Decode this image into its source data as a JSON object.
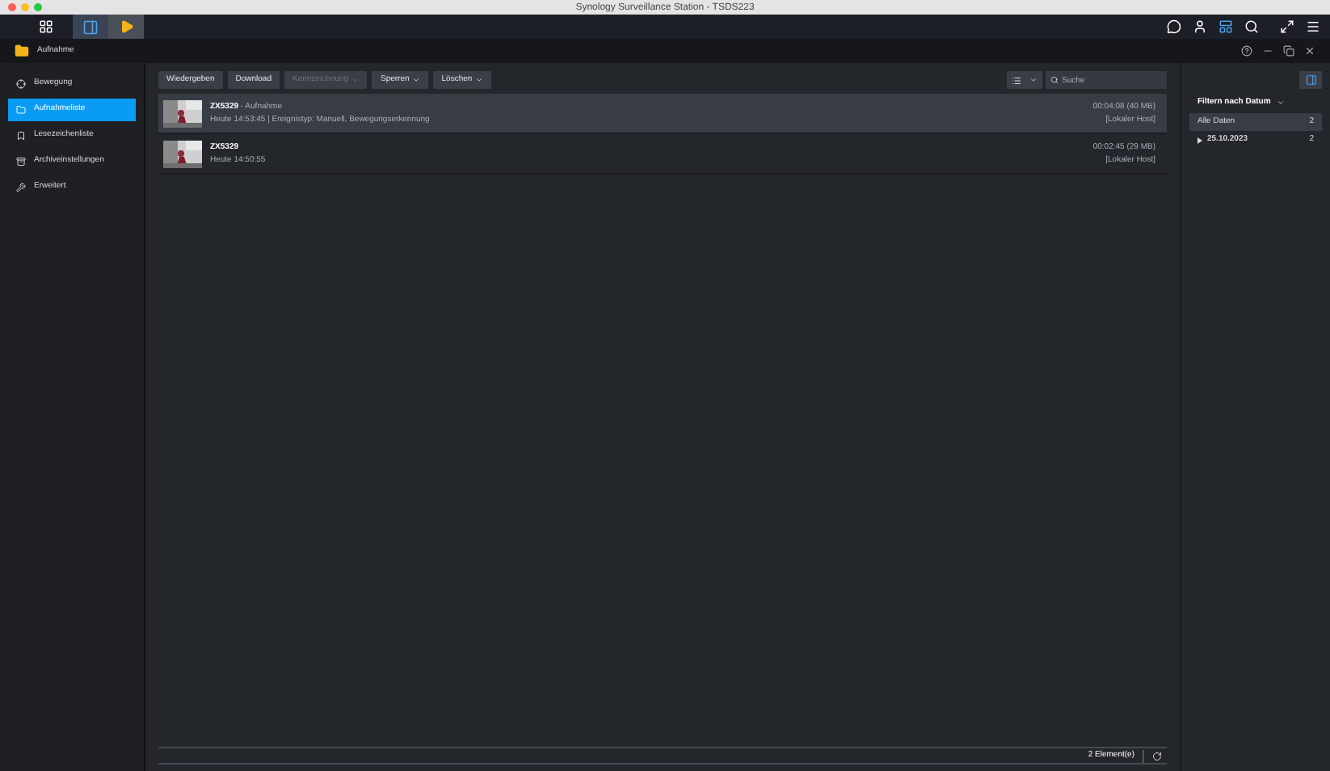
{
  "mac_title": "Synology Surveillance Station - TSDS223",
  "window": {
    "title": "Aufnahme"
  },
  "sidebar": {
    "items": [
      {
        "label": "Bewegung",
        "selected": false
      },
      {
        "label": "Aufnahmeliste",
        "selected": true
      },
      {
        "label": "Lesezeichenliste",
        "selected": false
      },
      {
        "label": "Archiveinstellungen",
        "selected": false
      },
      {
        "label": "Erweitert",
        "selected": false
      }
    ]
  },
  "toolbar": {
    "buttons": [
      {
        "label": "Wiedergeben",
        "disabled": false,
        "dropdown": false
      },
      {
        "label": "Download",
        "disabled": false,
        "dropdown": false
      },
      {
        "label": "Kennzeichnung",
        "disabled": true,
        "dropdown": true
      },
      {
        "label": "Sperren",
        "disabled": false,
        "dropdown": true
      },
      {
        "label": "Löschen",
        "disabled": false,
        "dropdown": true
      }
    ],
    "search": {
      "placeholder": "Suche"
    }
  },
  "recordings": [
    {
      "camera": "ZX5329",
      "type": "- Aufnahme",
      "details": "Heute 14:53:45 | Ereignistyp: Manuell, Bewegungserkennung",
      "duration": "00:04:08 (40 MB)",
      "host": "[Lokaler Host]",
      "selected": true
    },
    {
      "camera": "ZX5329",
      "details": "Heute 14:50:55",
      "duration": "00:02:45 (29 MB)",
      "host": "[Lokaler Host]",
      "selected": false
    }
  ],
  "footer": {
    "count": "2 Element(e)"
  },
  "filter": {
    "title": "Filtern nach Datum",
    "items": [
      {
        "label": "Alle Daten",
        "count": "2",
        "selected": true
      },
      {
        "label": "25.10.2023",
        "count": "2",
        "selected": false
      }
    ]
  }
}
